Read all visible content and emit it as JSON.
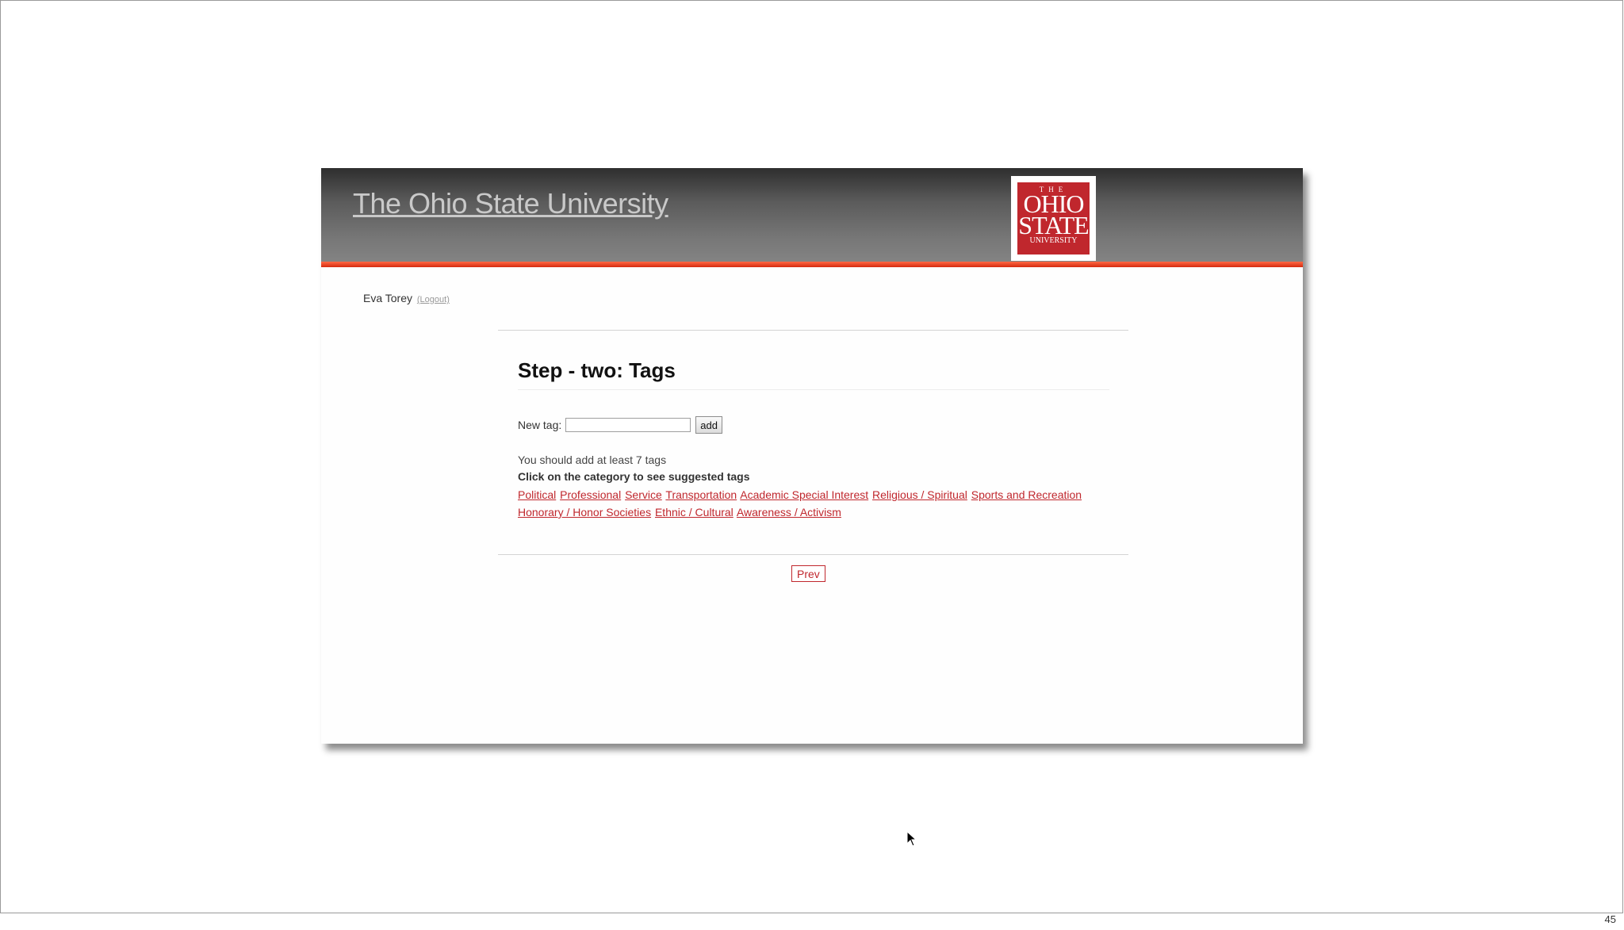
{
  "header": {
    "site_title": "The Ohio State University",
    "logo_text": {
      "the": "THE",
      "ohio": "OHIO",
      "state": "STATE",
      "university": "UNIVERSITY"
    }
  },
  "user": {
    "name": "Eva Torey",
    "logout_label": "(Logout)"
  },
  "step": {
    "title": "Step - two: Tags"
  },
  "new_tag": {
    "label": "New tag:",
    "value": "",
    "add_label": "add"
  },
  "hint": "You should add at least 7 tags",
  "instruction": "Click on the category to see suggested tags",
  "categories": [
    "Political",
    "Professional",
    "Service",
    "Transportation",
    "Academic Special Interest",
    "Religious / Spiritual",
    "Sports and Recreation",
    "Honorary / Honor Societies",
    "Ethnic / Cultural",
    "Awareness / Activism"
  ],
  "nav": {
    "prev_label": "Prev"
  },
  "slide_number": "45",
  "colors": {
    "accent_red": "#c0272d",
    "header_stripe": "#e0301a",
    "header_dark": "#2e2e2e"
  }
}
